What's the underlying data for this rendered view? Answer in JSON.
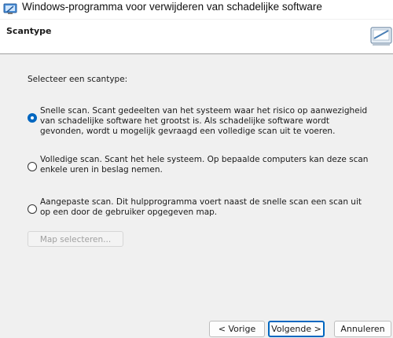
{
  "window": {
    "title": "Windows-programma voor verwijderen van schadelijke software",
    "icon": "malware-removal-app-icon"
  },
  "header": {
    "title": "Scantype",
    "icon": "scanner-icon"
  },
  "main": {
    "prompt": "Selecteer een scantype:",
    "options": [
      {
        "label": "Snelle scan. Scant gedeelten van het systeem waar het risico op aanwezigheid van schadelijke software het grootst is. Als schadelijke software wordt gevonden, wordt u mogelijk gevraagd een volledige scan uit te voeren.",
        "checked": true
      },
      {
        "label": "Volledige scan. Scant het hele systeem. Op bepaalde computers kan deze scan enkele uren in beslag nemen.",
        "checked": false
      },
      {
        "label": "Aangepaste scan. Dit hulpprogramma voert naast de snelle scan een scan uit op een door de gebruiker opgegeven map.",
        "checked": false
      }
    ],
    "select_folder_label": "Map selecteren...",
    "select_folder_enabled": false
  },
  "footer": {
    "back_label": "< Vorige",
    "next_label": "Volgende >",
    "cancel_label": "Annuleren"
  },
  "colors": {
    "accent": "#0067c0",
    "panel_background": "#f0f0f0",
    "header_background": "#ffffff"
  }
}
